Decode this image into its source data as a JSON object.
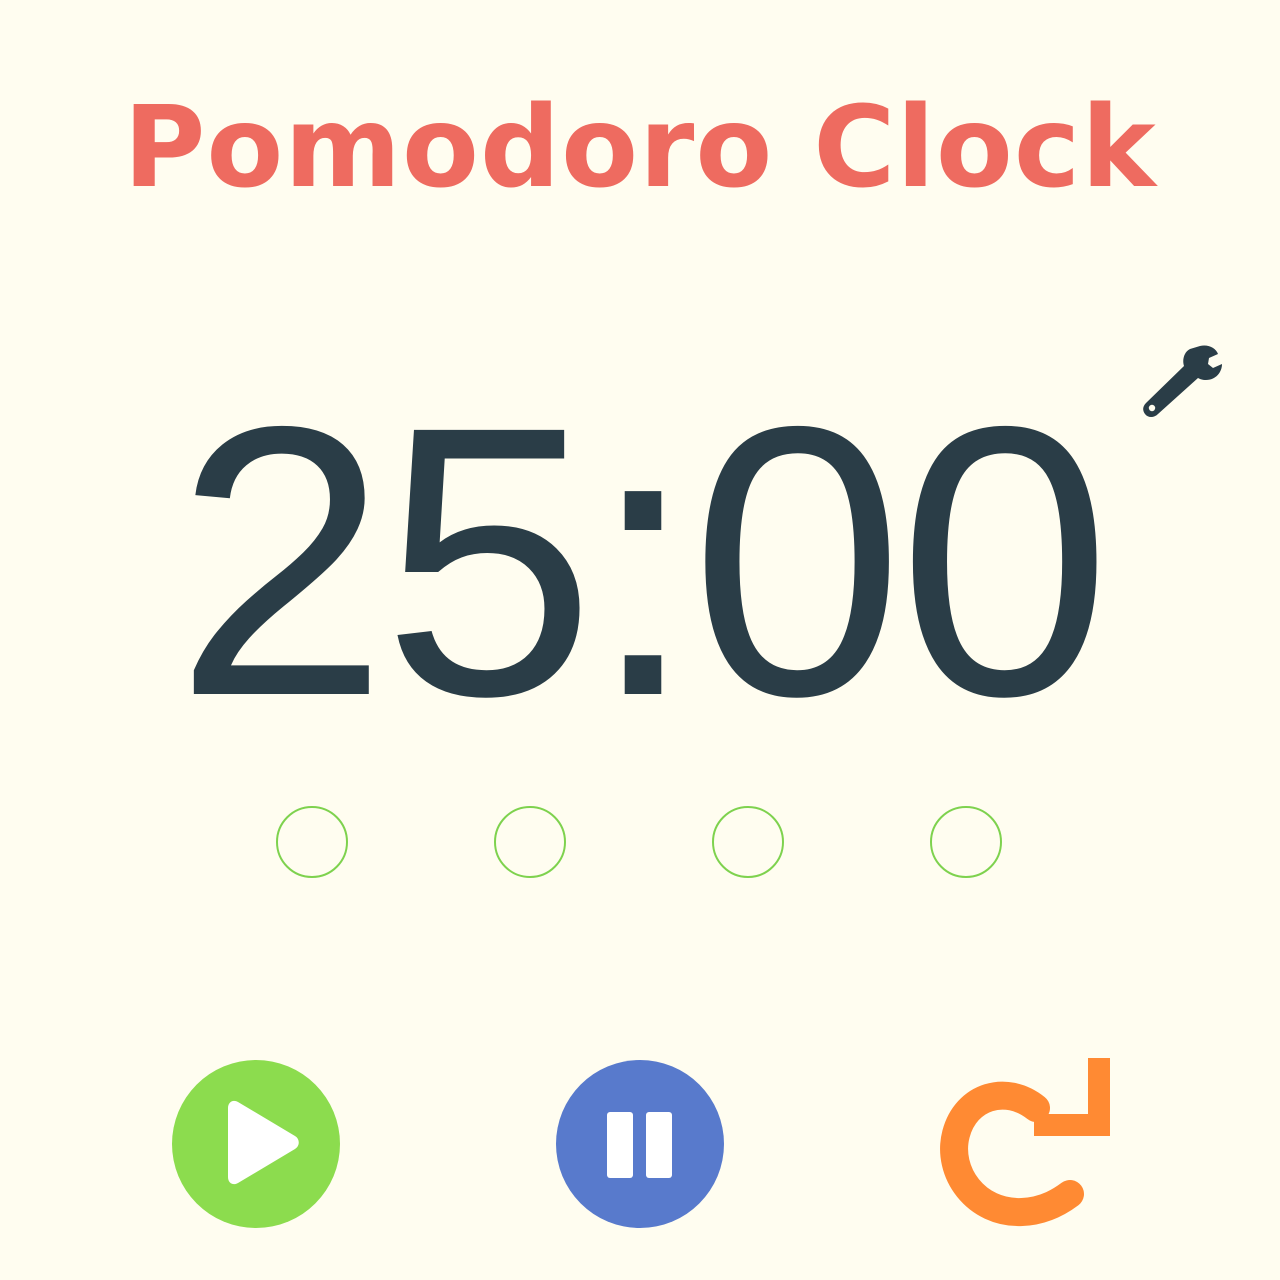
{
  "app": {
    "title": "Pomodoro Clock"
  },
  "timer": {
    "display": "25:00"
  },
  "sessions": {
    "total": 4,
    "completed": 0
  },
  "controls": {
    "play": {
      "icon": "play-icon",
      "color": "#8cdc4e"
    },
    "pause": {
      "icon": "pause-icon",
      "color": "#587acc"
    },
    "reset": {
      "icon": "reset-icon",
      "color": "#ff8a33"
    }
  },
  "settings": {
    "icon": "wrench-icon"
  },
  "colors": {
    "background": "#fffdf0",
    "title": "#ee6b60",
    "timer": "#2a3d47",
    "session_dot": "#7ed24e"
  }
}
